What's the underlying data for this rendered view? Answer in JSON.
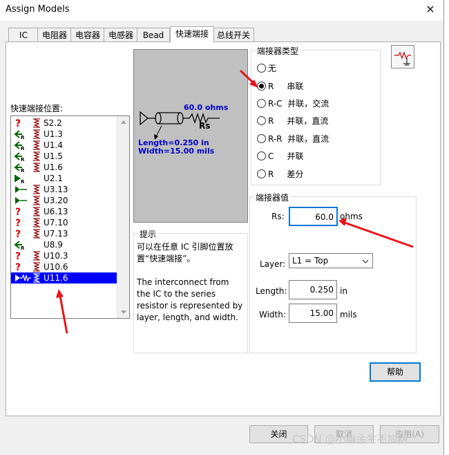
{
  "window": {
    "title": "Assign Models",
    "close_glyph": "✕"
  },
  "tabs": [
    {
      "label": "IC"
    },
    {
      "label": "电阻器"
    },
    {
      "label": "电容器"
    },
    {
      "label": "电感器"
    },
    {
      "label": "Bead"
    },
    {
      "label": "快速端接"
    },
    {
      "label": "总线开关"
    }
  ],
  "active_tab": "快速端接",
  "positions": {
    "label": "快速端接位置:",
    "items": [
      {
        "name": "S2.2",
        "icon": "question-icon",
        "has_model_icon": true,
        "selected": false
      },
      {
        "name": "U1.3",
        "icon": "arrow-left-r-icon",
        "has_model_icon": true,
        "selected": false
      },
      {
        "name": "U1.4",
        "icon": "arrow-left-r-icon",
        "has_model_icon": true,
        "selected": false
      },
      {
        "name": "U1.5",
        "icon": "arrow-left-r-icon",
        "has_model_icon": true,
        "selected": false
      },
      {
        "name": "U1.6",
        "icon": "arrow-left-r-icon",
        "has_model_icon": true,
        "selected": false
      },
      {
        "name": "U2.1",
        "icon": "arrow-right-r-icon",
        "has_model_icon": false,
        "selected": false
      },
      {
        "name": "U3.13",
        "icon": "driver-icon",
        "has_model_icon": true,
        "selected": false
      },
      {
        "name": "U3.20",
        "icon": "driver-icon",
        "has_model_icon": true,
        "selected": false
      },
      {
        "name": "U6.13",
        "icon": "question-icon",
        "has_model_icon": true,
        "selected": false
      },
      {
        "name": "U7.10",
        "icon": "question-icon",
        "has_model_icon": true,
        "selected": false
      },
      {
        "name": "U7.13",
        "icon": "question-icon",
        "has_model_icon": true,
        "selected": false
      },
      {
        "name": "U8.9",
        "icon": "arrow-left-r-icon",
        "has_model_icon": false,
        "selected": false
      },
      {
        "name": "U10.3",
        "icon": "question-icon",
        "has_model_icon": true,
        "selected": false
      },
      {
        "name": "U10.6",
        "icon": "question-icon",
        "has_model_icon": true,
        "selected": false
      },
      {
        "name": "U11.6",
        "icon": "driver-resistor-icon",
        "has_model_icon": true,
        "selected": true
      }
    ]
  },
  "preview": {
    "impedance": "60.0 ohms",
    "resistor_label": "Rs",
    "length_text": "Length=0.250 in",
    "width_text": "Width=15.00 mils"
  },
  "terminator_type": {
    "title": "端接器类型",
    "options": [
      {
        "label": "无",
        "checked": false
      },
      {
        "label": "R     串联",
        "checked": true
      },
      {
        "label": "R-C  并联，交流",
        "checked": false
      },
      {
        "label": "R     并联，直流",
        "checked": false
      },
      {
        "label": "R-R  并联，直流",
        "checked": false
      },
      {
        "label": "C     并联",
        "checked": false
      },
      {
        "label": "R     差分",
        "checked": false
      }
    ]
  },
  "hint": {
    "title": "提示",
    "text1": "可以在任意 IC 引脚位置放置“快速端接”。",
    "text2": "The interconnect from the IC to the series resistor is represented by layer, length, and width."
  },
  "terminator_values": {
    "title": "端接器值",
    "rs_label": "Rs:",
    "rs_value": "60.0",
    "rs_unit": "ohms",
    "layer_label": "Layer:",
    "layer_value": "L1 = Top",
    "length_label": "Length:",
    "length_value": "0.250",
    "length_unit": "in",
    "width_label": "Width:",
    "width_value": "15.00",
    "width_unit": "mils"
  },
  "buttons": {
    "help": "帮助",
    "close": "关闭",
    "cancel": "取消",
    "apply": "应用(A)"
  },
  "watermark": "CSDN @小幽余生不加糖",
  "colors": {
    "selection": "#0000ff",
    "preview_text": "#0000cc",
    "annotation_arrow": "#e8141a"
  }
}
